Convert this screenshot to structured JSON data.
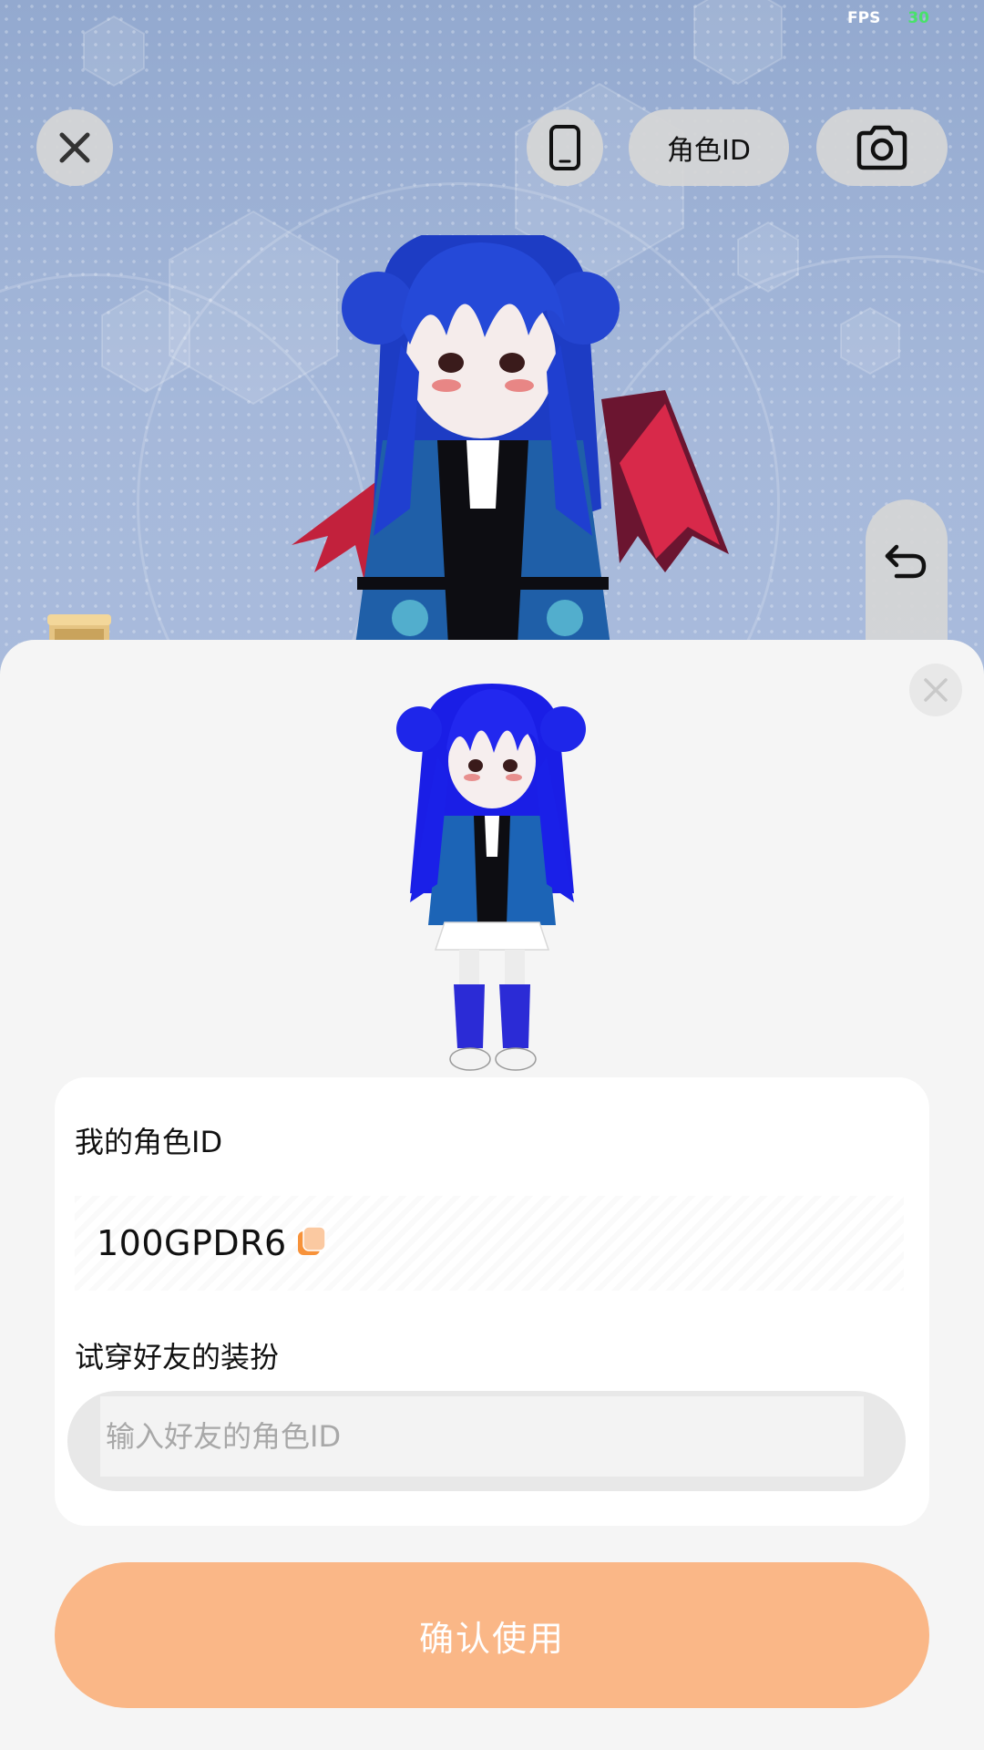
{
  "fps": {
    "label": "FPS",
    "value": "30"
  },
  "toolbar": {
    "close_icon": "close-icon",
    "phone_icon": "phone-icon",
    "role_id_label": "角色ID",
    "camera_icon": "camera-icon",
    "undo_icon": "undo-icon"
  },
  "sheet": {
    "my_id_label": "我的角色ID",
    "my_id_value": "100GPDR6",
    "copy_icon": "copy-icon",
    "try_on_label": "试穿好友的装扮",
    "friend_id_placeholder": "输入好友的角色ID",
    "friend_id_value": "",
    "confirm_label": "确认使用"
  },
  "colors": {
    "accent": "#fab787",
    "copy_icon": "#f7923a",
    "fps_value": "#48e26a"
  }
}
